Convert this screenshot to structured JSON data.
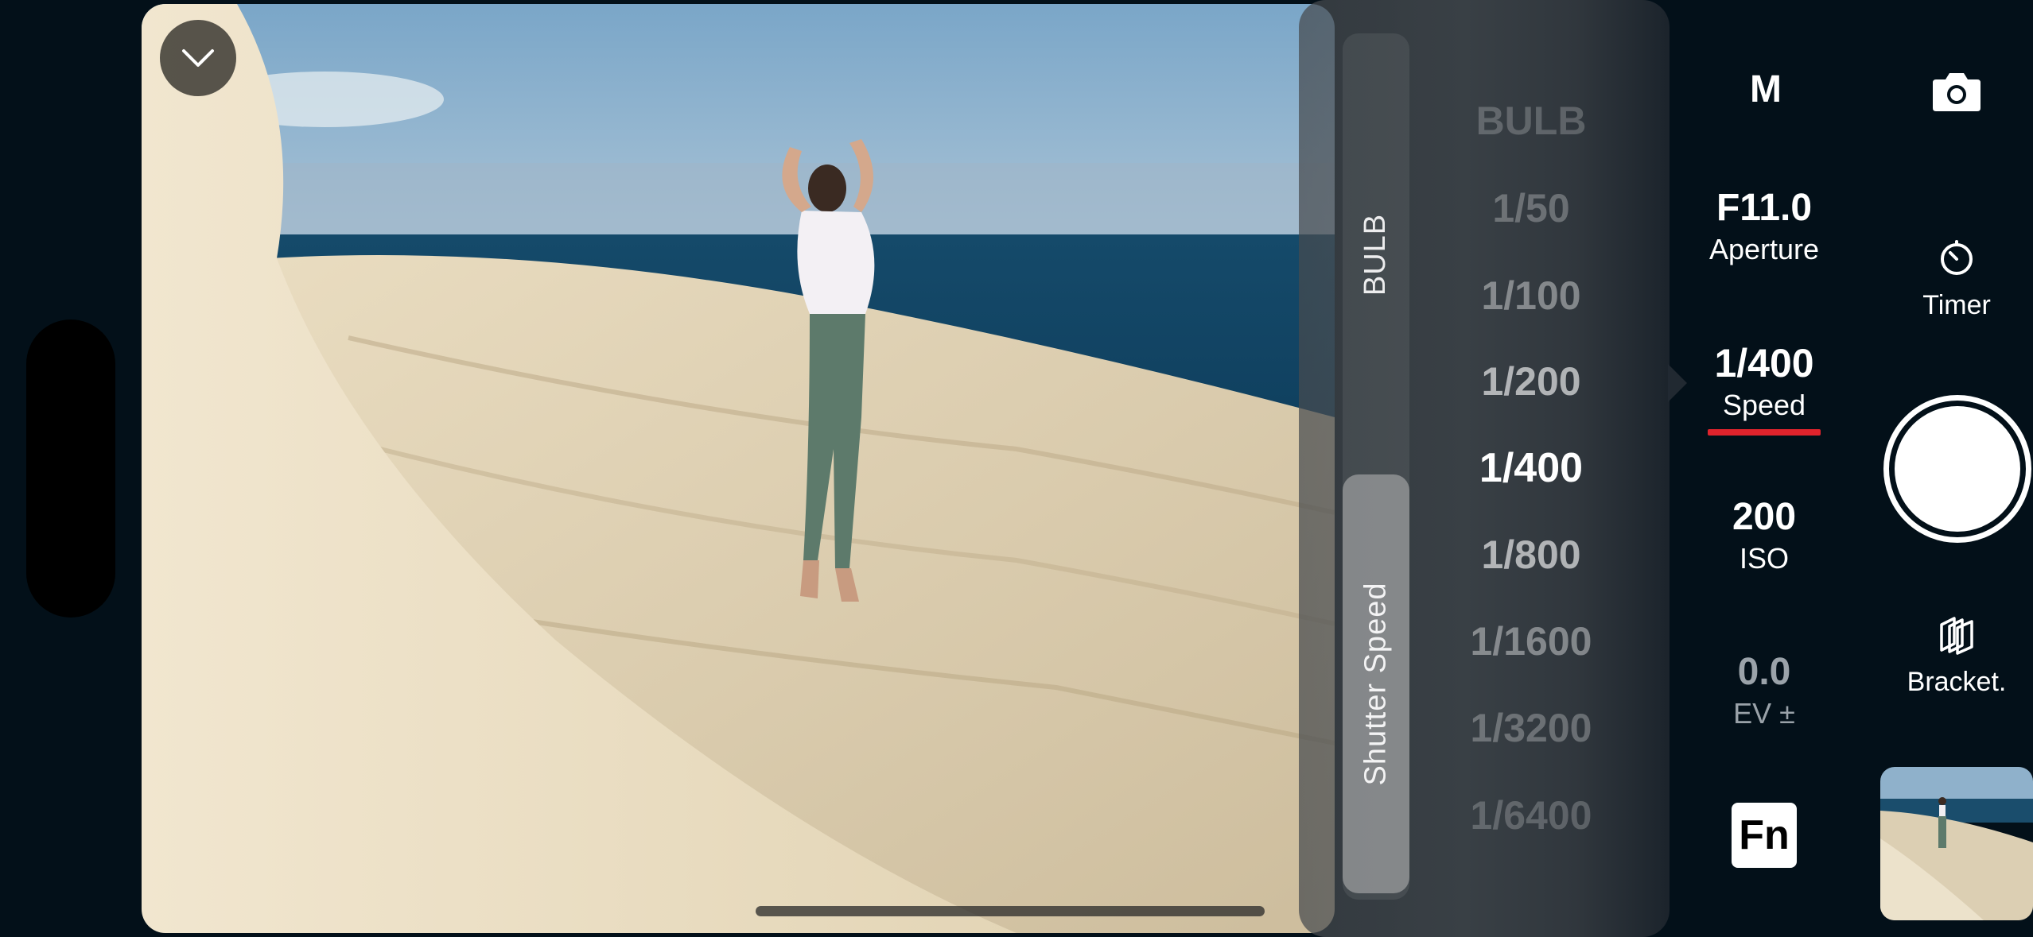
{
  "mode": "M",
  "picker": {
    "bulb_label": "BULB",
    "shutter_speed_label": "Shutter Speed",
    "speeds": [
      {
        "label": "BULB",
        "selected": false,
        "opacity": 0.22
      },
      {
        "label": "1/50",
        "selected": false,
        "opacity": 0.28
      },
      {
        "label": "1/100",
        "selected": false,
        "opacity": 0.4
      },
      {
        "label": "1/200",
        "selected": false,
        "opacity": 0.62
      },
      {
        "label": "1/400",
        "selected": true,
        "opacity": 1.0
      },
      {
        "label": "1/800",
        "selected": false,
        "opacity": 0.62
      },
      {
        "label": "1/1600",
        "selected": false,
        "opacity": 0.4
      },
      {
        "label": "1/3200",
        "selected": false,
        "opacity": 0.28
      },
      {
        "label": "1/6400",
        "selected": false,
        "opacity": 0.22
      }
    ]
  },
  "controls": {
    "aperture": {
      "value": "F11.0",
      "label": "Aperture"
    },
    "speed": {
      "value": "1/400",
      "label": "Speed"
    },
    "iso": {
      "value": "200",
      "label": "ISO"
    },
    "ev": {
      "value": "0.0",
      "label": "EV ±"
    },
    "fn_label": "Fn"
  },
  "actions": {
    "timer_label": "Timer",
    "bracket_label": "Bracket."
  },
  "colors": {
    "background": "#031019",
    "accent_underline": "#e0232c"
  },
  "icons": {
    "collapse": "chevron-down-icon",
    "camera": "camera-icon",
    "timer": "timer-icon",
    "bracket": "bracket-icon"
  }
}
